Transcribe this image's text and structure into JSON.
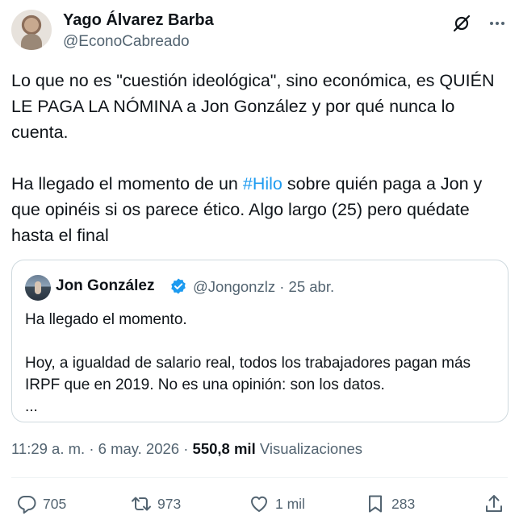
{
  "author": {
    "name": "Yago Álvarez Barba",
    "handle": "@EconoCabreado"
  },
  "tweet": {
    "paragraph1": "Lo que no es \"cuestión ideológica\", sino económica, es QUIÉN LE PAGA LA NÓMINA a Jon González y por qué nunca lo cuenta.",
    "paragraph2_before": "Ha llegado el momento de un ",
    "hashtag": "#Hilo",
    "paragraph2_after": " sobre quién paga a Jon y que opinéis si os parece ético. Algo largo (25) pero quédate hasta el final"
  },
  "quoted": {
    "name": "Jon González",
    "handle": "@Jongonzlz",
    "date": "25 abr.",
    "line1": "Ha llegado el momento.",
    "line2": "Hoy, a igualdad de salario real, todos los trabajadores pagan más IRPF que en 2019. No es una opinión: son los datos.",
    "ellipsis": "..."
  },
  "meta": {
    "time": "11:29 a. m.",
    "date": "6 may. 2026",
    "views_count": "550,8 mil",
    "views_label": "Visualizaciones"
  },
  "actions": {
    "replies": "705",
    "retweets": "973",
    "likes": "1 mil",
    "bookmarks": "283"
  },
  "icons": {
    "grok": "grok-slash-icon",
    "more": "more-dots-icon",
    "verified": "verified-badge-icon",
    "reply": "reply-bubble-icon",
    "retweet": "retweet-arrows-icon",
    "like": "heart-icon",
    "bookmark": "bookmark-icon",
    "share": "share-upload-icon"
  },
  "colors": {
    "accent": "#1d9bf0",
    "text": "#0f1419",
    "secondary": "#536471",
    "border": "#cfd9de"
  }
}
